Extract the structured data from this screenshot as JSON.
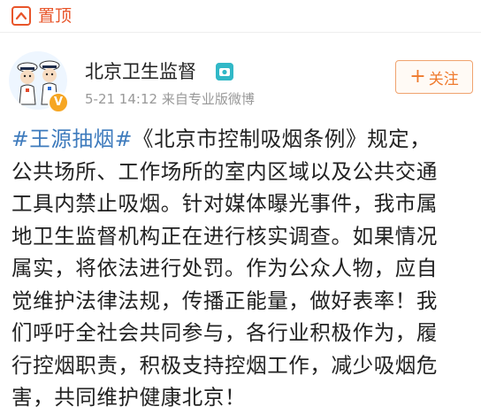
{
  "pin_bar": {
    "label": "置顶",
    "icon": "pin-icon"
  },
  "author": {
    "name": "北京卫生监督",
    "timestamp": "5-21 14:12",
    "source": "来自专业版微博",
    "avatar_icon": "police-cartoon-avatar",
    "verified_icon": "verified-badge-icon",
    "verified_mark": "V",
    "member_icon": "member-camera-icon"
  },
  "follow_button": {
    "plus": "+",
    "label": "关注"
  },
  "post": {
    "hashtag": "#王源抽烟#",
    "line1_rest": "《北京市控制吸烟条例》规定，",
    "lines": [
      "公共场所、工作场所的室内区域以及公共交通",
      "工具内禁止吸烟。针对媒体曝光事件，我市属",
      "地卫生监督机构正在进行核实调查。如果情况",
      "属实，将依法进行处罚。作为公众人物，应自",
      "觉维护法律法规，传播正能量，做好表率！我",
      "们呼吁全社会共同参与，各行业积极作为，履",
      "行控烟职责，积极支持控烟工作，减少吸烟危",
      "害，共同维护健康北京！"
    ]
  },
  "colors": {
    "accent": "#e8552a",
    "link": "#3e7bbd",
    "follow": "#ef7a2d",
    "meta": "#999999"
  }
}
